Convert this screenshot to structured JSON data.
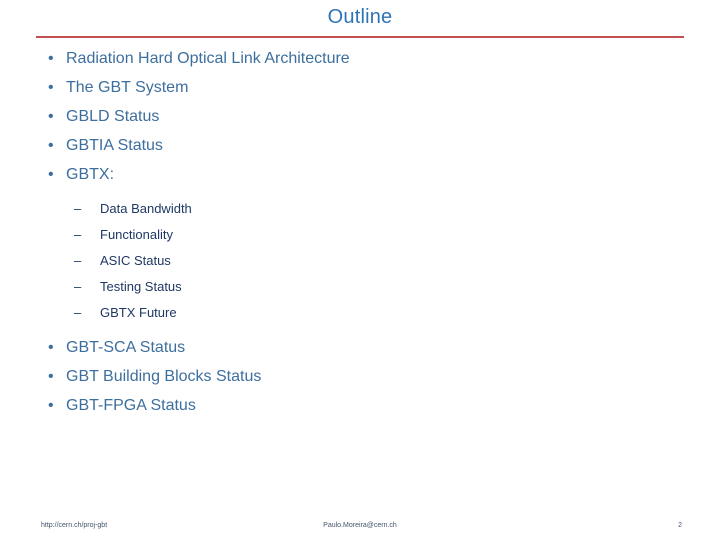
{
  "slide": {
    "title": "Outline",
    "title_color": "#2E74B5",
    "rule_color": "#C0504D",
    "bullet_level1_glyph": "•",
    "bullet_level2_glyph": "–",
    "level1_color": "#3D6F9E",
    "level2_color": "#1F3864",
    "items_top": [
      {
        "label": "Radiation Hard Optical Link Architecture"
      },
      {
        "label": "The GBT System"
      },
      {
        "label": "GBLD Status"
      },
      {
        "label": "GBTIA Status"
      },
      {
        "label": "GBTX:"
      }
    ],
    "subitems": [
      {
        "label": "Data Bandwidth"
      },
      {
        "label": "Functionality"
      },
      {
        "label": "ASIC Status"
      },
      {
        "label": "Testing Status"
      },
      {
        "label": "GBTX Future"
      }
    ],
    "items_bottom": [
      {
        "label": "GBT-SCA Status"
      },
      {
        "label": "GBT Building Blocks Status"
      },
      {
        "label": "GBT-FPGA Status"
      }
    ]
  },
  "footer": {
    "left": "http://cern.ch/proj-gbt",
    "center": "Paulo.Moreira@cern.ch",
    "right": "2"
  }
}
